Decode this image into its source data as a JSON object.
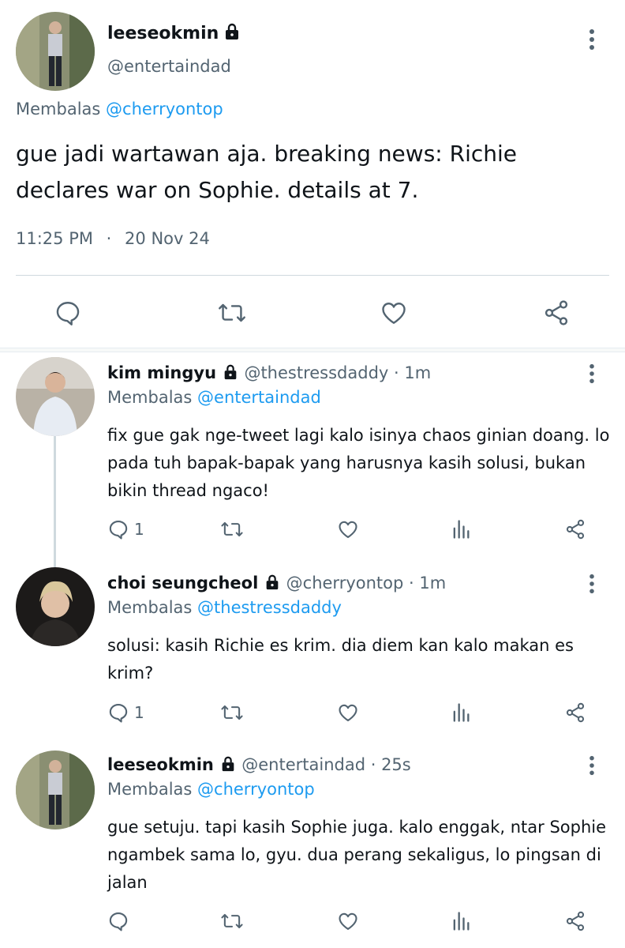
{
  "main_tweet": {
    "display_name": "leeseokmin",
    "handle": "@entertaindad",
    "reply_prefix": "Membalas",
    "reply_to": "@cherryontop",
    "text": "gue jadi wartawan aja. breaking news: Richie declares war on Sophie. details at 7.",
    "time": "11:25 PM",
    "separator": "·",
    "date": "20 Nov 24",
    "actions": [
      "reply-icon",
      "retweet-icon",
      "like-icon",
      "share-icon"
    ]
  },
  "replies": [
    {
      "display_name": "kim mingyu",
      "handle": "@thestressdaddy",
      "age": "· 1m",
      "reply_prefix": "Membalas",
      "reply_to": "@entertaindad",
      "text": "fix gue gak nge-tweet lagi kalo isinya chaos ginian doang. lo pada tuh bapak-bapak yang harusnya kasih solusi, bukan bikin thread ngaco!",
      "reply_count": "1"
    },
    {
      "display_name": "choi seungcheol",
      "handle": "@cherryontop",
      "age": "· 1m",
      "reply_prefix": "Membalas",
      "reply_to": "@thestressdaddy",
      "text": "solusi: kasih Richie es krim. dia diem kan kalo makan es krim?",
      "reply_count": "1"
    },
    {
      "display_name": "leeseokmin",
      "handle": "@entertaindad",
      "age": "· 25s",
      "reply_prefix": "Membalas",
      "reply_to": "@cherryontop",
      "text": "gue setuju. tapi kasih Sophie juga. kalo enggak, ntar Sophie ngambek sama lo, gyu. dua perang sekaligus, lo pingsan di jalan",
      "reply_count": ""
    }
  ],
  "colors": {
    "text": "#0f1419",
    "secondary": "#536471",
    "link": "#1d9bf0",
    "divider": "#cfd9de"
  }
}
